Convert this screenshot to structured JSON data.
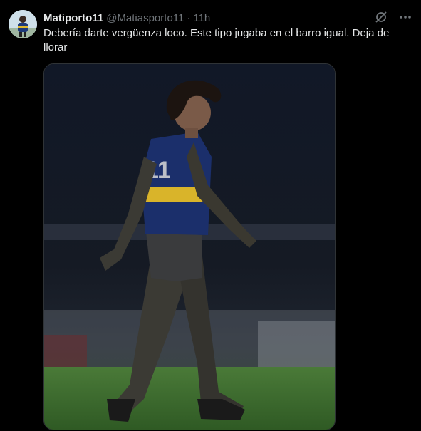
{
  "tweet": {
    "author_name": "Matiporto11",
    "author_handle": "@Matiasporto11",
    "separator": "·",
    "time": "11h",
    "text": "Debería darte vergüenza loco. Este tipo jugaba en el barro igual. Deja de llorar"
  },
  "icons": {
    "avatar": "user-avatar",
    "grok": "grok-icon",
    "more": "more-options-icon"
  },
  "media": {
    "shirt_number": "11",
    "colors": {
      "shirt_blue": "#1b2f6b",
      "shirt_yellow": "#d9b42a",
      "mud": "#3b3a34",
      "grass": "#3d6b2f"
    }
  }
}
